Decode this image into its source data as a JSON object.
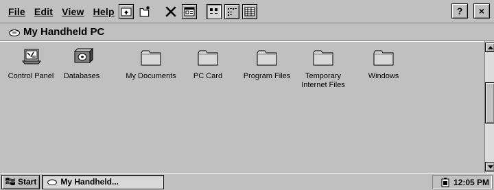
{
  "menu": {
    "file": "File",
    "edit": "Edit",
    "view": "View",
    "help": "Help"
  },
  "toolbar": {
    "buttons": [
      {
        "icon": "up-folder-icon"
      },
      {
        "icon": "new-folder-icon"
      },
      {
        "icon": "delete-icon"
      },
      {
        "icon": "properties-icon"
      },
      {
        "icon": "large-icons-icon"
      },
      {
        "icon": "small-icons-icon"
      },
      {
        "icon": "details-icon"
      }
    ],
    "help_button": "?",
    "close_button": "×"
  },
  "address": {
    "title": "My Handheld PC",
    "icon": "handheld-pc-icon"
  },
  "items": [
    {
      "label": "Control Panel",
      "icon": "control-panel-icon"
    },
    {
      "label": "Databases",
      "icon": "databases-icon"
    },
    {
      "label": "My Documents",
      "icon": "folder-icon"
    },
    {
      "label": "PC Card",
      "icon": "folder-icon"
    },
    {
      "label": "Program Files",
      "icon": "folder-icon"
    },
    {
      "label_line1": "Temporary",
      "label_line2": "Internet Files",
      "icon": "folder-icon"
    },
    {
      "label": "Windows",
      "icon": "folder-icon"
    }
  ],
  "taskbar": {
    "start": "Start",
    "task": "My Handheld...",
    "time": "12:05 PM"
  }
}
